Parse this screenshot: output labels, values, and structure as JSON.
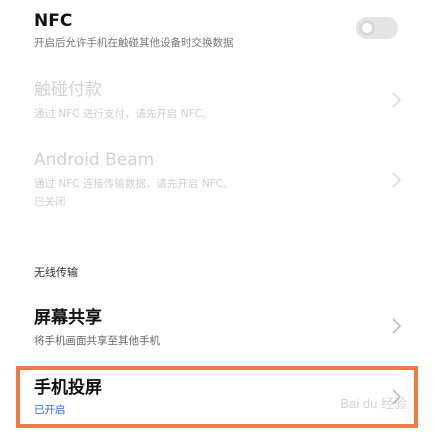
{
  "nfc": {
    "title": "NFC",
    "description": "开启后允许手机在触碰其他设备时交换数据",
    "toggle_on": false
  },
  "tap_pay": {
    "title": "触碰付款",
    "description": "通过 NFC 进行支付，请先开启 NFC。"
  },
  "android_beam": {
    "title": "Android Beam",
    "description": "通过 NFC 连接传输数据，请先开启 NFC。",
    "status": "已关闭"
  },
  "wireless": {
    "header": "无线传输",
    "screen_share": {
      "title": "屏幕共享",
      "description": "将手机画面共享至其他手机"
    },
    "cast": {
      "title": "手机投屏",
      "status": "已开启"
    }
  },
  "colors": {
    "highlight": "#f07a45",
    "status_on": "#2d6ae3"
  },
  "watermark": {
    "text": "Bai du 经验"
  }
}
